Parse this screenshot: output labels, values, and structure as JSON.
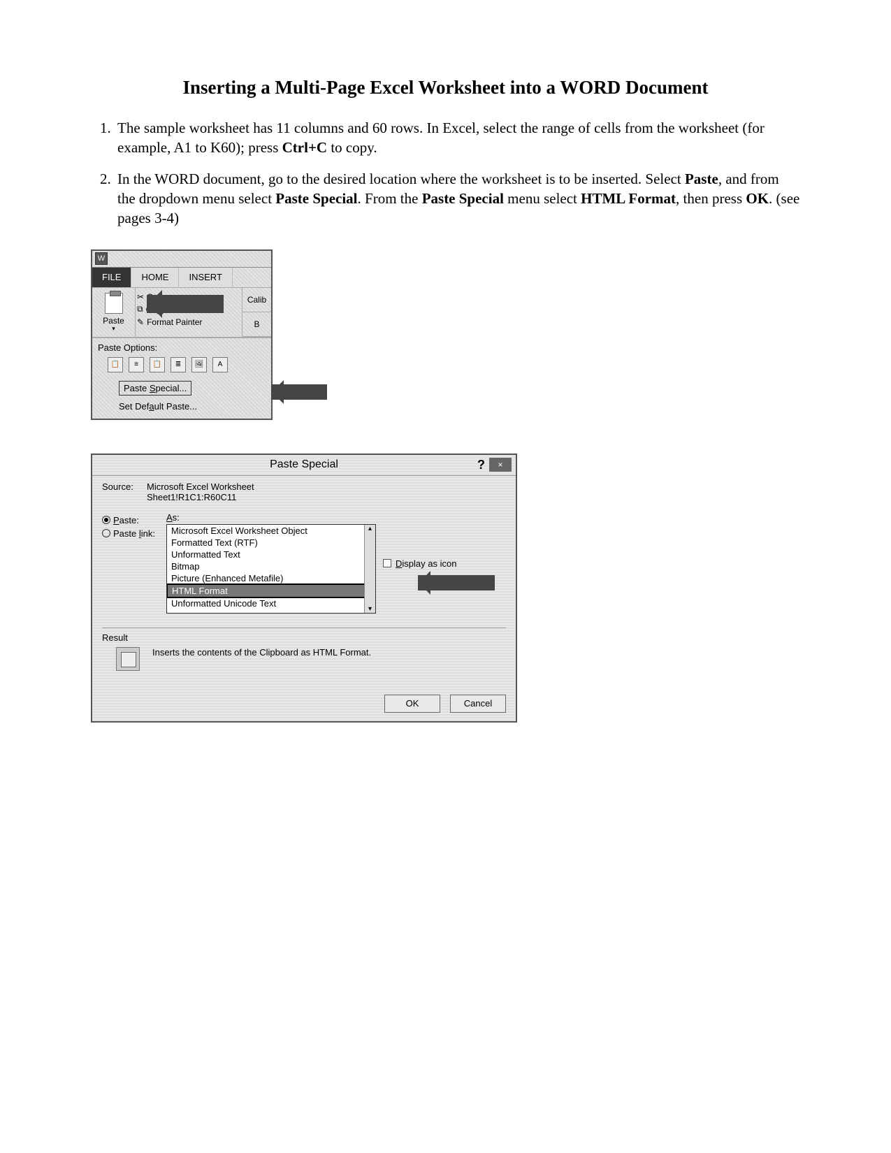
{
  "title": "Inserting a Multi-Page Excel Worksheet into a WORD Document",
  "steps": {
    "s1_a": "The sample worksheet has 11 columns and 60 rows. In Excel, select the range of cells from the worksheet (for example, A1 to K60); press ",
    "s1_bold": "Ctrl+C",
    "s1_b": " to copy.",
    "s2_a": "In the WORD document, go to the desired location where the worksheet is to be inserted. Select ",
    "s2_b1": "Paste",
    "s2_c": ", and from the dropdown menu select ",
    "s2_b2": "Paste Special",
    "s2_d": ". From the ",
    "s2_b3": "Paste Special",
    "s2_e": " menu select ",
    "s2_b4": "HTML Format",
    "s2_f": ", then press ",
    "s2_b5": "OK",
    "s2_g": ". (see pages 3-4)"
  },
  "ribbon": {
    "tabs": {
      "file": "FILE",
      "home": "HOME",
      "insert": "INSERT"
    },
    "paste": "Paste",
    "cut": "Cut",
    "copy": "Copy",
    "format_painter": "Format Painter",
    "right1": "Calib",
    "right2": "B",
    "paste_options": "Paste Options:",
    "paste_special_pre": "Paste ",
    "paste_special_u": "S",
    "paste_special_post": "pecial...",
    "set_default_pre": "Set Def",
    "set_default_u": "a",
    "set_default_post": "ult Paste..."
  },
  "dialog": {
    "title": "Paste Special",
    "help": "?",
    "close_x": "×",
    "source_label": "Source:",
    "source_val1": "Microsoft Excel Worksheet",
    "source_val2": "Sheet1!R1C1:R60C11",
    "as_pre": "",
    "as_u": "A",
    "as_post": "s:",
    "radio_paste_u": "P",
    "radio_paste_post": "aste:",
    "radio_pastelink_pre": "Paste ",
    "radio_pastelink_u": "l",
    "radio_pastelink_post": "ink:",
    "opts": {
      "o0": "Microsoft Excel Worksheet Object",
      "o1": "Formatted Text (RTF)",
      "o2": "Unformatted Text",
      "o3": "Bitmap",
      "o4": "Picture (Enhanced Metafile)",
      "o5": "HTML Format",
      "o6": "Unformatted Unicode Text"
    },
    "display_u": "D",
    "display_post": "isplay as icon",
    "result_hdr": "Result",
    "result_txt": "Inserts the contents of the Clipboard as HTML Format.",
    "ok": "OK",
    "cancel": "Cancel"
  }
}
